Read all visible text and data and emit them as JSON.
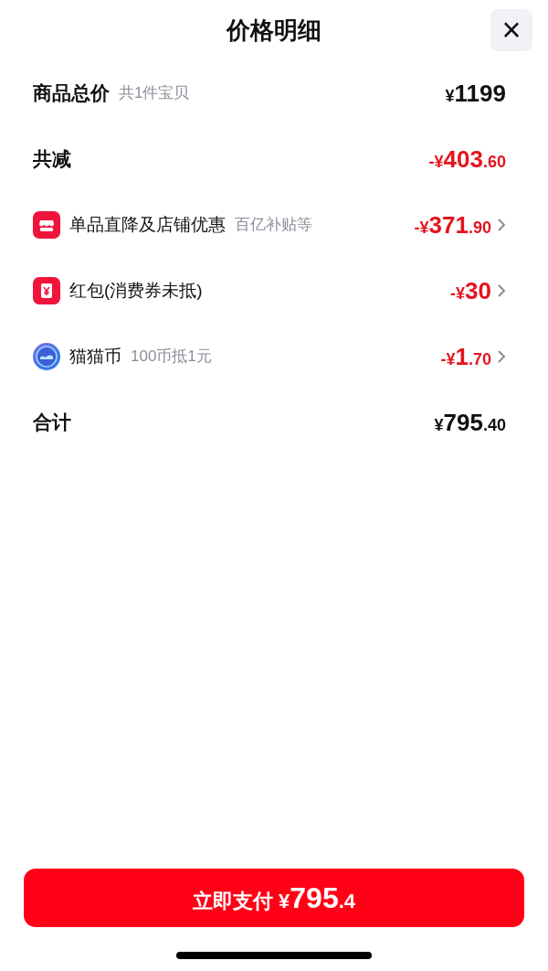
{
  "sheet": {
    "title": "价格明细",
    "close": "×"
  },
  "rows": [
    {
      "kind": "heading",
      "label": "商品总价",
      "note": "共1件宝贝",
      "amount": {
        "symbol": "¥",
        "whole": "1199"
      },
      "negative": false
    },
    {
      "kind": "heading",
      "label": "共减",
      "amount": {
        "sign": "-",
        "symbol": "¥",
        "whole": "403",
        "fraction": ".60"
      },
      "negative": true
    },
    {
      "kind": "store",
      "label": "单品直降及店铺优惠",
      "note": "百亿补贴等",
      "amount": {
        "sign": "-",
        "symbol": "¥",
        "whole": "371",
        "fraction": ".90"
      },
      "negative": true
    },
    {
      "kind": "voucher",
      "label": "红包(消费券未抵)",
      "amount": {
        "sign": "-",
        "symbol": "¥",
        "whole": "30"
      },
      "negative": true
    },
    {
      "kind": "coin",
      "label": "猫猫币",
      "note": "100币抵1元",
      "amount": {
        "sign": "-",
        "symbol": "¥",
        "whole": "1",
        "fraction": ".70"
      },
      "negative": true
    },
    {
      "kind": "heading",
      "label": "合计",
      "amount": {
        "symbol": "¥",
        "whole": "795",
        "fraction": ".40"
      },
      "negative": false
    }
  ],
  "pay_button": {
    "label": "立即支付",
    "amount": {
      "symbol": "¥",
      "whole": "795",
      "fraction": ".4"
    }
  }
}
